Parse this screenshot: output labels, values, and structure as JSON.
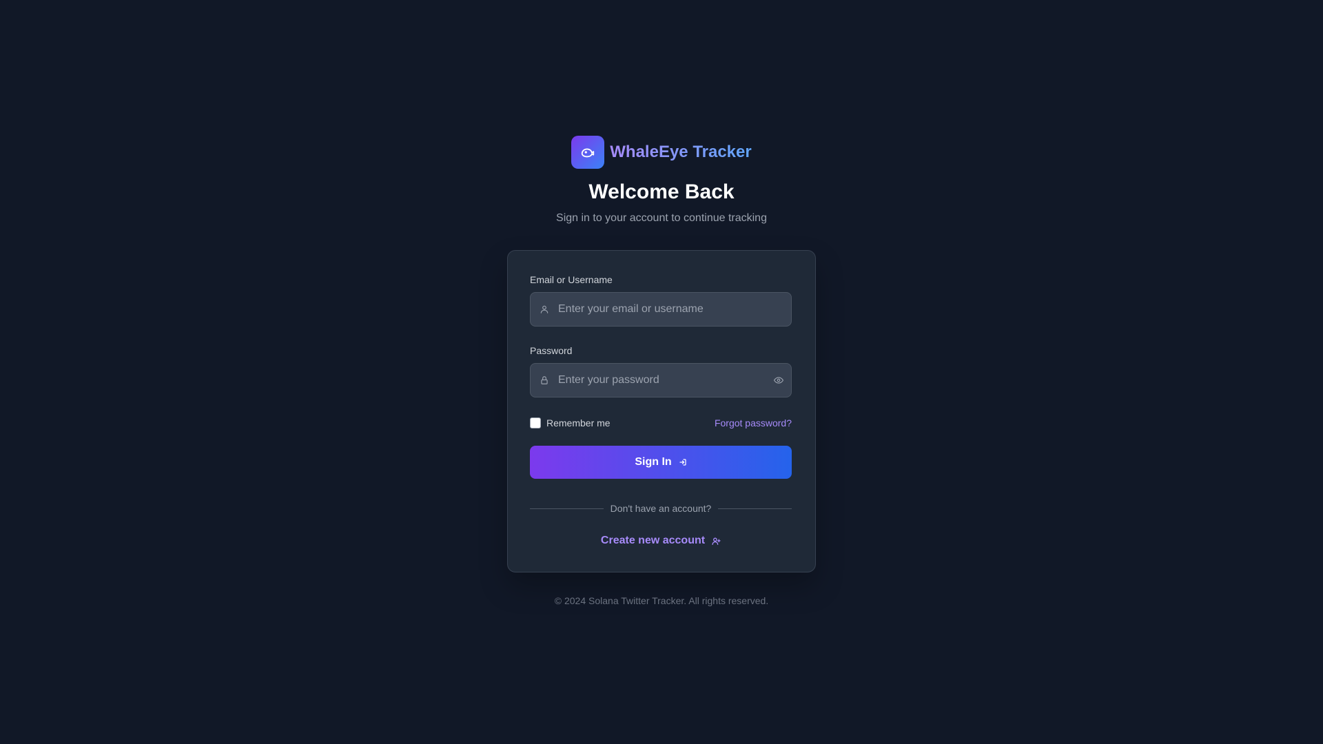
{
  "brand": {
    "name": "WhaleEye Tracker",
    "logo_icon": "whale-icon"
  },
  "header": {
    "title": "Welcome Back",
    "subtitle": "Sign in to your account to continue tracking"
  },
  "form": {
    "email": {
      "label": "Email or Username",
      "placeholder": "Enter your email or username",
      "value": "",
      "icon": "user-icon"
    },
    "password": {
      "label": "Password",
      "placeholder": "Enter your password",
      "value": "",
      "icon": "lock-icon",
      "toggle_icon": "eye-icon"
    },
    "remember_label": "Remember me",
    "remember_checked": false,
    "forgot_label": "Forgot password?",
    "submit_label": "Sign In",
    "submit_icon": "arrow-right-icon"
  },
  "signup": {
    "divider_text": "Don't have an account?",
    "link_label": "Create new account",
    "link_icon": "user-plus-icon"
  },
  "footer": {
    "copyright": "© 2024 Solana Twitter Tracker. All rights reserved."
  },
  "colors": {
    "background": "#111827",
    "card": "#1f2937",
    "accent_purple": "#7c3aed",
    "accent_blue": "#2563eb",
    "link": "#a78bfa"
  }
}
